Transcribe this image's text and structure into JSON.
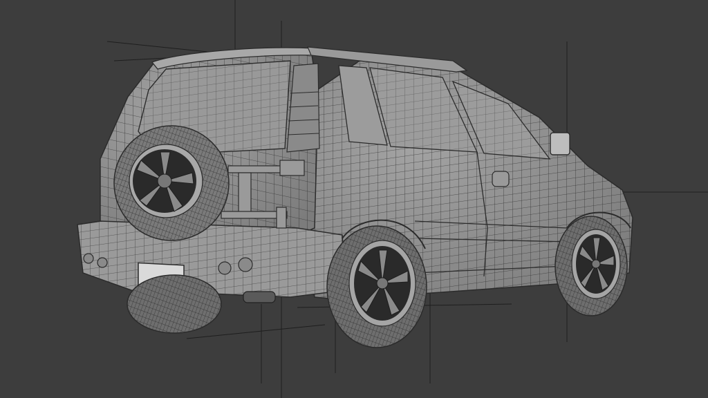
{
  "viewport": {
    "background": "#3d3d3d",
    "wire_color": "#2b2b2b",
    "surface_color": "#8f8f8f",
    "tire_color": "#6e6e6e",
    "wheel_color": "#2a2a2a",
    "guide_color": "#1e1e1e"
  },
  "model": {
    "subject": "suv-wireframe-mesh",
    "view": "rear-three-quarter"
  }
}
